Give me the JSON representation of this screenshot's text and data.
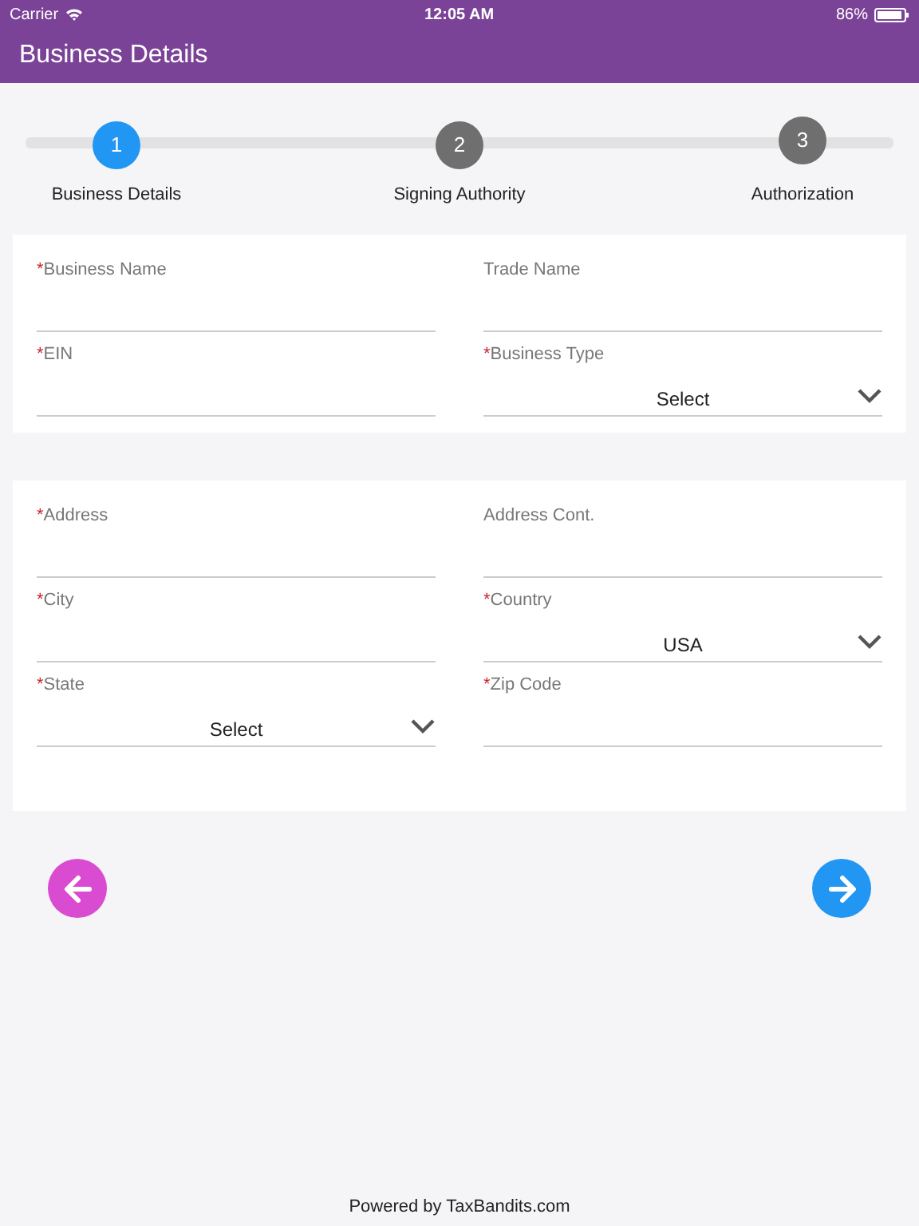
{
  "status_bar": {
    "carrier": "Carrier",
    "time": "12:05 AM",
    "battery": "86%"
  },
  "header": {
    "title": "Business Details"
  },
  "steps": [
    {
      "number": "1",
      "label": "Business Details",
      "selected": true
    },
    {
      "number": "2",
      "label": "Signing Authority",
      "selected": false
    },
    {
      "number": "3",
      "label": "Authorization",
      "selected": false
    }
  ],
  "sections": [
    {
      "fields": [
        {
          "kind": "text",
          "label": "Business Name",
          "required_mark": "*"
        },
        {
          "kind": "text",
          "label": "Trade Name"
        },
        {
          "kind": "text",
          "label": "EIN",
          "required_mark": "*"
        },
        {
          "kind": "select",
          "label": "Business Type",
          "required_mark": "*",
          "value": "Select"
        }
      ]
    },
    {
      "fields": [
        {
          "kind": "text",
          "label": "Address",
          "required_mark": "*"
        },
        {
          "kind": "text",
          "label": "Address Cont."
        },
        {
          "kind": "text",
          "label": "City",
          "required_mark": "*"
        },
        {
          "kind": "select",
          "label": "Country",
          "required_mark": "*",
          "value": "USA"
        },
        {
          "kind": "select",
          "label": "State",
          "required_mark": "*",
          "value": "Select"
        },
        {
          "kind": "text",
          "label": "Zip Code",
          "required_mark": "*"
        }
      ]
    }
  ],
  "footer": "Powered by TaxBandits.com"
}
